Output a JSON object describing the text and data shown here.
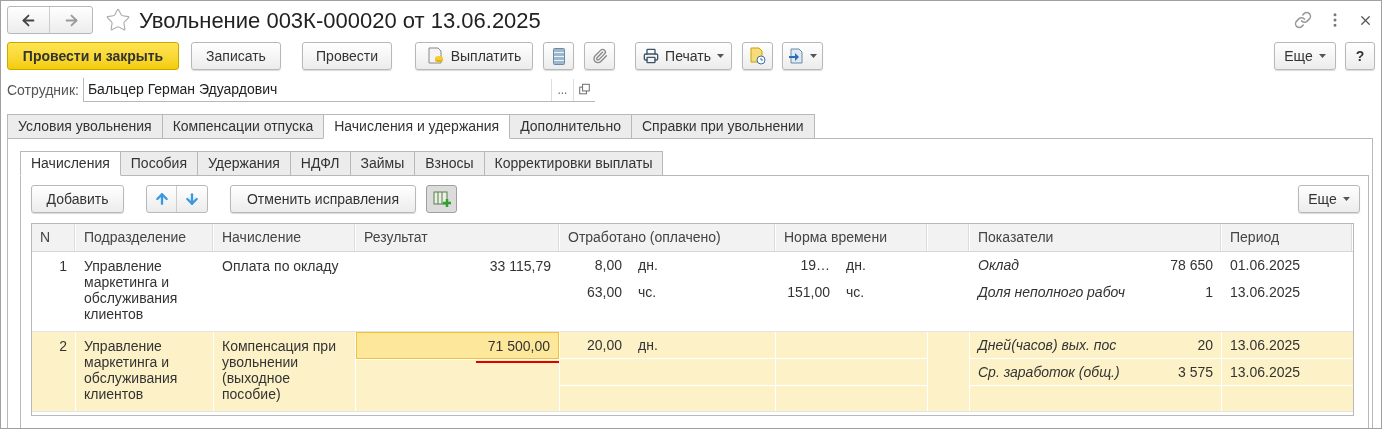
{
  "window": {
    "title": "Увольнение 003К-000020 от 13.06.2025",
    "favorite": false
  },
  "toolbar": {
    "primary": "Провести и закрыть",
    "buttons": [
      "Записать",
      "Провести"
    ],
    "pay": "Выплатить",
    "print": "Печать",
    "more": "Еще",
    "help": "?"
  },
  "employee": {
    "label": "Сотрудник:",
    "value": "Бальцер Герман Эдуардович",
    "select": "..."
  },
  "tabs": [
    {
      "label": "Условия увольнения",
      "selected": false
    },
    {
      "label": "Компенсации отпуска",
      "selected": false
    },
    {
      "label": "Начисления и удержания",
      "selected": true
    },
    {
      "label": "Дополнительно",
      "selected": false
    },
    {
      "label": "Справки при увольнении",
      "selected": false
    }
  ],
  "subtabs": [
    {
      "label": "Начисления",
      "selected": true
    },
    {
      "label": "Пособия",
      "selected": false
    },
    {
      "label": "Удержания",
      "selected": false
    },
    {
      "label": "НДФЛ",
      "selected": false
    },
    {
      "label": "Займы",
      "selected": false
    },
    {
      "label": "Взносы",
      "selected": false
    },
    {
      "label": "Корректировки выплаты",
      "selected": false
    }
  ],
  "table_toolbar": {
    "add": "Добавить",
    "cancel": "Отменить исправления",
    "more": "Еще"
  },
  "table": {
    "columns": [
      "N",
      "Подразделение",
      "Начисление",
      "Результат",
      "Отработано (оплачено)",
      "Норма времени",
      "Показатели",
      "Период"
    ],
    "rows": [
      {
        "n": "1",
        "department": "Управление маркетинга и обслуживания клиентов",
        "accrual": "Оплата по окладу",
        "result": "33 115,79",
        "result_focused": false,
        "selected": false,
        "worked": [
          {
            "value": "8,00",
            "unit": "дн."
          },
          {
            "value": "63,00",
            "unit": "чс."
          }
        ],
        "norm": [
          {
            "value": "19…",
            "unit": "дн."
          },
          {
            "value": "151,00",
            "unit": "чс."
          }
        ],
        "indicators": [
          {
            "name": "Оклад",
            "value": "78 650",
            "period": "01.06.2025"
          },
          {
            "name": "Доля неполного рабоч",
            "value": "1",
            "period": "13.06.2025"
          }
        ]
      },
      {
        "n": "2",
        "department": "Управление маркетинга и обслуживания клиентов",
        "accrual": "Компенсация при увольнении (выходное пособие)",
        "result": "71 500,00",
        "result_focused": true,
        "selected": true,
        "worked": [
          {
            "value": "20,00",
            "unit": "дн."
          }
        ],
        "norm": [],
        "indicators": [
          {
            "name": "Дней(часов) вых. пос",
            "value": "20",
            "period": "13.06.2025"
          },
          {
            "name": "Ср. заработок (общ.)",
            "value": "3 575",
            "period": "13.06.2025"
          }
        ]
      }
    ]
  }
}
